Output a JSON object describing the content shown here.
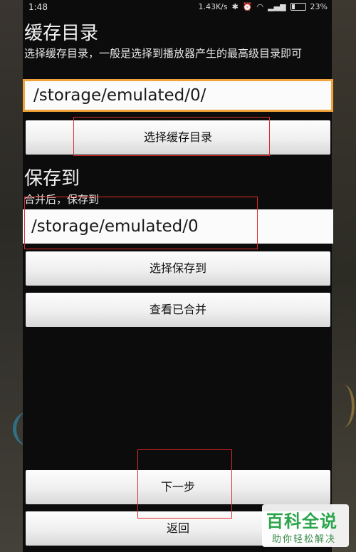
{
  "status_bar": {
    "time": "1:48",
    "net_speed": "1.43K/s",
    "battery": "23%"
  },
  "cache_section": {
    "title": "缓存目录",
    "description": "选择缓存目录，一般是选择到播放器产生的最高级目录即可",
    "path_value": "/storage/emulated/0/",
    "select_button": "选择缓存目录"
  },
  "save_section": {
    "title": "保存到",
    "description": "合并后，保存到",
    "path_value": "/storage/emulated/0",
    "select_button": "选择保存到",
    "view_button": "查看已合并"
  },
  "bottom": {
    "next_button": "下一步",
    "back_button": "返回"
  },
  "watermark": {
    "main": "百科全说",
    "sub": "助你轻松解决"
  },
  "colors": {
    "focus_border": "#f0a43a",
    "annotation": "#e02a2a",
    "watermark": "#2aa54a"
  }
}
